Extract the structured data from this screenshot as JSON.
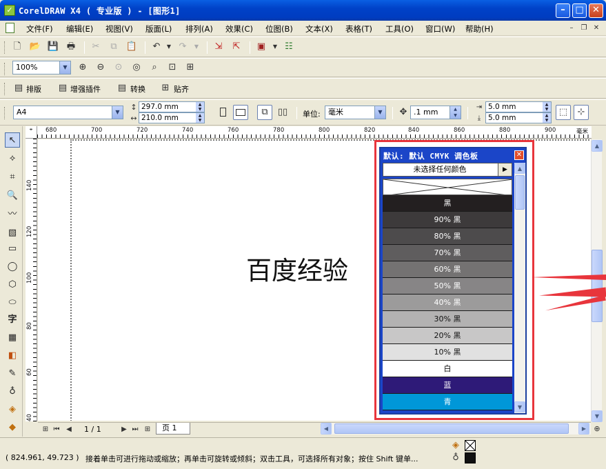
{
  "window": {
    "title": "CorelDRAW X4 ( 专业版 ) - [图形1]",
    "controls": {
      "minimize": "–",
      "maximize": "□",
      "close": "✕"
    }
  },
  "menu": {
    "items": [
      "文件(F)",
      "编辑(E)",
      "视图(V)",
      "版面(L)",
      "排列(A)",
      "效果(C)",
      "位图(B)",
      "文本(X)",
      "表格(T)",
      "工具(O)",
      "窗口(W)",
      "帮助(H)"
    ]
  },
  "zoom": {
    "value": "100%"
  },
  "plugins": {
    "items": [
      "排版",
      "增强插件",
      "转换",
      "贴齐"
    ]
  },
  "property_bar": {
    "page_size": "A4",
    "width": "297.0 mm",
    "height": "210.0 mm",
    "unit_label": "单位:",
    "unit": "毫米",
    "nudge": ".1 mm",
    "dup_x": "5.0 mm",
    "dup_y": "5.0 mm"
  },
  "rulers": {
    "horizontal": [
      "680",
      "700",
      "720",
      "740",
      "760",
      "780",
      "800",
      "820",
      "840",
      "860",
      "880",
      "900"
    ],
    "horizontal_unit": "毫米",
    "vertical": [
      "140",
      "120",
      "100",
      "80",
      "60",
      "40"
    ]
  },
  "canvas": {
    "text": "百度经验"
  },
  "palette": {
    "title": "默认: 默认 CMYK 调色板",
    "selector": "未选择任何颜色",
    "swatches": [
      {
        "label": "黑",
        "color": "#231f20",
        "text": "#ffffff"
      },
      {
        "label": "90% 黑",
        "color": "#3d3a3b",
        "text": "#ffffff"
      },
      {
        "label": "80% 黑",
        "color": "#4d4b4c",
        "text": "#ffffff"
      },
      {
        "label": "70% 黑",
        "color": "#5f5d5e",
        "text": "#ffffff"
      },
      {
        "label": "60% 黑",
        "color": "#747272",
        "text": "#ffffff"
      },
      {
        "label": "50% 黑",
        "color": "#878586",
        "text": "#ffffff"
      },
      {
        "label": "40% 黑",
        "color": "#9c9b9b",
        "text": "#ffffff"
      },
      {
        "label": "30% 黑",
        "color": "#b3b2b2",
        "text": "#111111"
      },
      {
        "label": "20% 黑",
        "color": "#c8c7c7",
        "text": "#111111"
      },
      {
        "label": "10% 黑",
        "color": "#e1e1e1",
        "text": "#111111"
      },
      {
        "label": "白",
        "color": "#ffffff",
        "text": "#111111"
      },
      {
        "label": "蓝",
        "color": "#2e1a78",
        "text": "#ffffff"
      },
      {
        "label": "青",
        "color": "#0097d8",
        "text": "#ffffff"
      }
    ]
  },
  "page_nav": {
    "pager": "1 / 1",
    "tab": "页 1"
  },
  "status": {
    "coords": "( 824.961, 49.723 )",
    "message": "接着单击可进行拖动或缩放；再单击可旋转或倾斜；双击工具，可选择所有对象；按住 Shift 键单..."
  },
  "annotation_color": "#e8353c"
}
